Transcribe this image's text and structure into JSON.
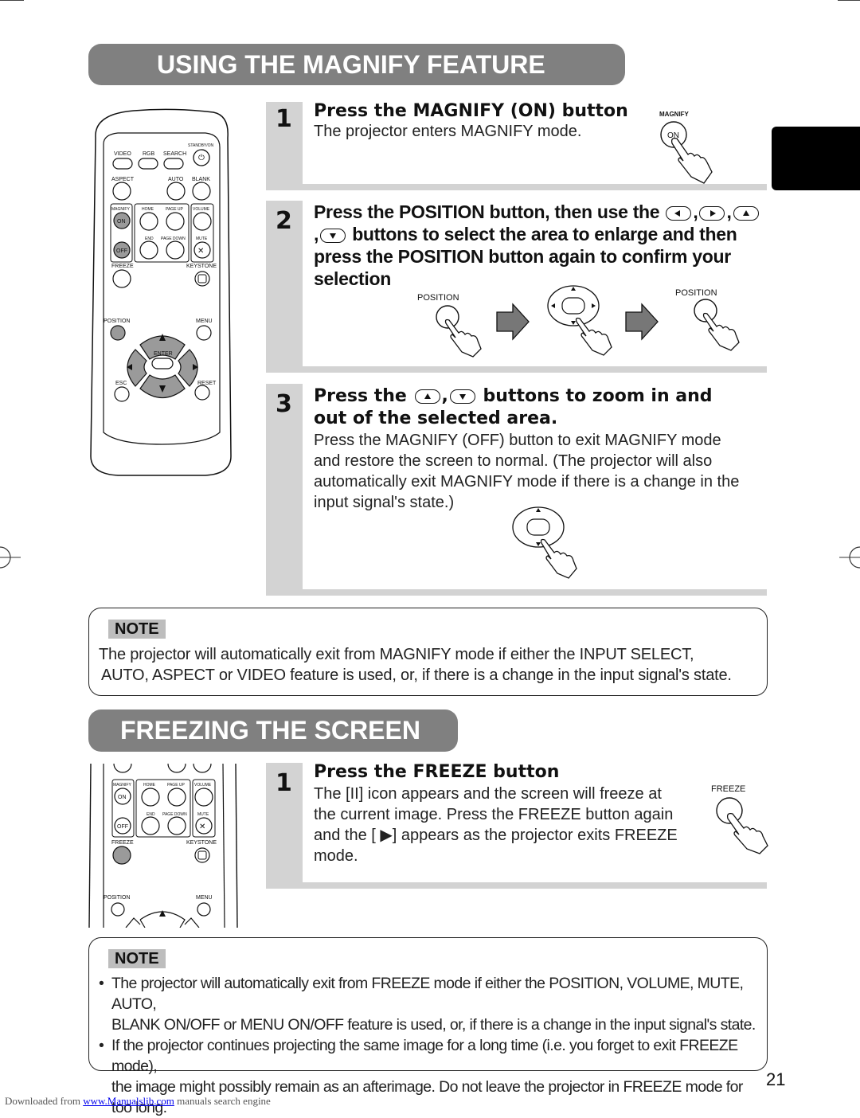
{
  "page": {
    "number": "21",
    "footer": {
      "prefix": "Downloaded from",
      "link": "www.Manualslib.com",
      "suffix": "manuals search engine"
    }
  },
  "magnify": {
    "title": "USING THE MAGNIFY FEATURE",
    "steps": [
      {
        "number": "1",
        "heading": "Press the MAGNIFY (ON) button",
        "body": "The projector enters MAGNIFY mode.",
        "illustration": {
          "label_top": "MAGNIFY",
          "button_label": "ON"
        }
      },
      {
        "number": "2",
        "heading_parts": [
          "Press the POSITION button, then use the",
          ",",
          ",",
          ",",
          "buttons to select the area to enlarge and then",
          "press the POSITION button again to confirm your",
          "selection"
        ],
        "illustration": {
          "label_left": "POSITION",
          "label_right": "POSITION"
        }
      },
      {
        "number": "3",
        "heading_parts": [
          "Press the",
          ",",
          "buttons to zoom in and",
          "out of the selected area."
        ],
        "body_lines": [
          "Press the MAGNIFY (OFF) button to exit MAGNIFY mode",
          "and restore the screen to normal. (The projector will also",
          "automatically exit MAGNIFY mode if there is a change in the",
          "input signal's state.)"
        ]
      }
    ],
    "note": {
      "label": "NOTE",
      "lines": [
        "The projector will automatically exit from MAGNIFY mode if either the INPUT SELECT,",
        "AUTO, ASPECT or VIDEO feature is used, or, if there is a change in the input signal's state."
      ]
    }
  },
  "freeze": {
    "title": "FREEZING THE SCREEN",
    "steps": [
      {
        "number": "1",
        "heading": "Press the FREEZE button",
        "body_lines": [
          "The [II] icon appears and the screen will freeze at",
          "the current image. Press the FREEZE button again",
          "and the [ ▶] appears as the projector exits FREEZE",
          "mode."
        ],
        "illustration": {
          "label_top": "FREEZE"
        }
      }
    ],
    "note": {
      "label": "NOTE",
      "bullets": [
        [
          "The projector will automatically exit from FREEZE mode if either the POSITION, VOLUME, MUTE, AUTO,",
          "BLANK ON/OFF or MENU ON/OFF feature is used, or, if there is a change in the input signal's state."
        ],
        [
          "If the projector continues projecting the same image for a long time (i.e. you forget to exit FREEZE mode),",
          "the image might possibly remain as an afterimage. Do not leave the projector in FREEZE mode for too long."
        ]
      ]
    }
  },
  "remote": {
    "labels": {
      "standby": "STANDBY/ON",
      "video": "VIDEO",
      "rgb": "RGB",
      "search": "SEARCH",
      "aspect": "ASPECT",
      "auto": "AUTO",
      "blank": "BLANK",
      "magnify": "MAGNIFY",
      "on": "ON",
      "off": "OFF",
      "home": "HOME",
      "page_up": "PAGE UP",
      "end": "END",
      "page_down": "PAGE DOWN",
      "volume": "VOLUME",
      "mute": "MUTE",
      "freeze": "FREEZE",
      "keystone": "KEYSTONE",
      "position": "POSITION",
      "menu": "MENU",
      "enter": "ENTER",
      "esc": "ESC",
      "reset": "RESET"
    }
  },
  "colors": {
    "banner": "#808080",
    "step_gutter": "#d3d3d3",
    "note_label": "#bdbdbd",
    "highlight_button": "#9a9a9a",
    "link": "#0000ee"
  }
}
